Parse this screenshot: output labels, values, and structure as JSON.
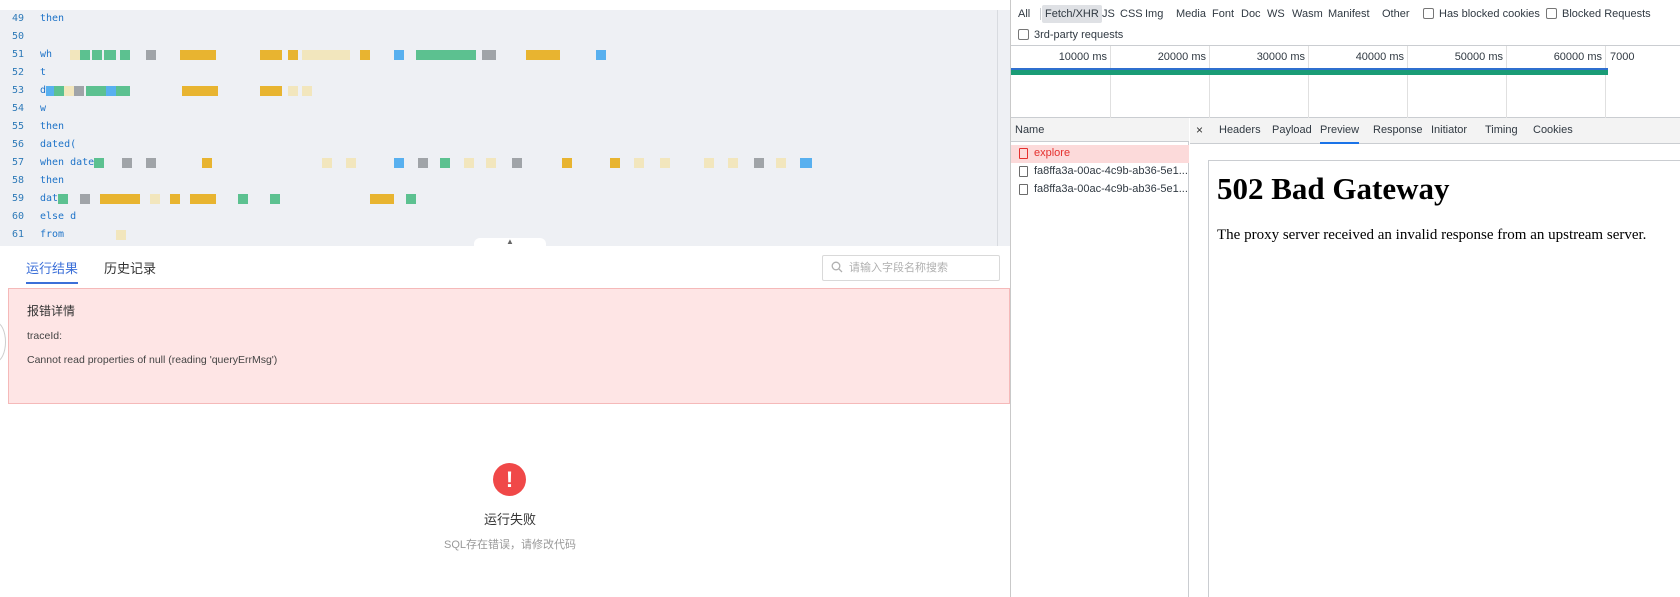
{
  "editor": {
    "lines": [
      {
        "num": "49",
        "text": "then"
      },
      {
        "num": "50",
        "text": ""
      },
      {
        "num": "51",
        "text": "wh"
      },
      {
        "num": "52",
        "text": "t"
      },
      {
        "num": "53",
        "text": "d"
      },
      {
        "num": "54",
        "text": "w"
      },
      {
        "num": "55",
        "text": "then"
      },
      {
        "num": "56",
        "text": "dated("
      },
      {
        "num": "57",
        "text": "when date_"
      },
      {
        "num": "58",
        "text": "then"
      },
      {
        "num": "59",
        "text": "dat"
      },
      {
        "num": "60",
        "text": "else d"
      },
      {
        "num": "61",
        "text": "from"
      }
    ],
    "colors": {
      "green": "#5cc190",
      "gray": "#a0a4a8",
      "yellow": "#e8b430",
      "blue": "#58b0ef",
      "paleyellow": "#f2e6bd"
    }
  },
  "result_tabs": {
    "run_result": "运行结果",
    "history": "历史记录",
    "search_placeholder": "请输入字段名称搜索"
  },
  "error_panel": {
    "title": "报错详情",
    "trace_label": "traceId:",
    "message": "Cannot read properties of null (reading 'queryErrMsg')"
  },
  "fail_state": {
    "icon": "!",
    "title": "运行失败",
    "subtitle": "SQL存在错误，请修改代码"
  },
  "devtools": {
    "filters": [
      "All",
      "Fetch/XHR",
      "JS",
      "CSS",
      "Img",
      "Media",
      "Font",
      "Doc",
      "WS",
      "Wasm",
      "Manifest",
      "Other"
    ],
    "active_filter": "Fetch/XHR",
    "has_blocked_cookies": "Has blocked cookies",
    "blocked_requests": "Blocked Requests",
    "third_party": "3rd-party requests",
    "timeline_labels": [
      "10000 ms",
      "20000 ms",
      "30000 ms",
      "40000 ms",
      "50000 ms",
      "60000 ms",
      "7000"
    ],
    "name_header": "Name",
    "requests": [
      {
        "name": "explore",
        "error": true
      },
      {
        "name": "fa8ffa3a-00ac-4c9b-ab36-5e1...",
        "error": false
      },
      {
        "name": "fa8ffa3a-00ac-4c9b-ab36-5e1...",
        "error": false
      }
    ],
    "detail_tabs": [
      "Headers",
      "Payload",
      "Preview",
      "Response",
      "Initiator",
      "Timing",
      "Cookies"
    ],
    "active_detail_tab": "Preview",
    "close_glyph": "×",
    "preview": {
      "heading": "502 Bad Gateway",
      "body": "The proxy server received an invalid response from an upstream server."
    },
    "accent_color": "#1a73e8",
    "error_color": "#e5302e"
  }
}
